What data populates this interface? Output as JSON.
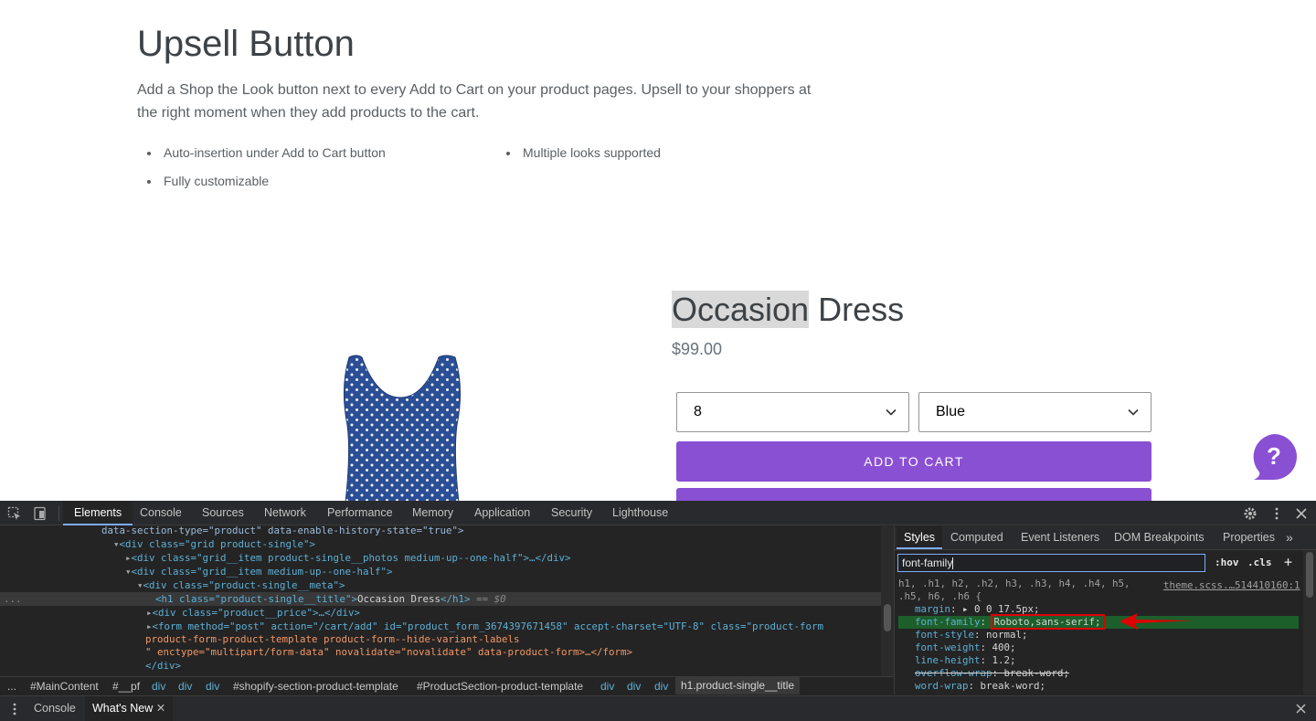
{
  "upsell": {
    "title": "Upsell Button",
    "description": "Add a Shop the Look button next to every Add to Cart on your product pages. Upsell to your shoppers at the right moment when they add products to the cart.",
    "features": [
      "Auto-insertion under Add to Cart button",
      "Multiple looks supported",
      "Fully customizable"
    ]
  },
  "product": {
    "title_highlighted": "Occasion",
    "title_rest": " Dress",
    "price": "$99.00",
    "size_value": "8",
    "color_value": "Blue",
    "add_to_cart_label": "ADD TO CART",
    "button_color": "#8a50d4"
  },
  "help": {
    "icon": "question-mark-icon",
    "glyph": "?"
  },
  "devtools": {
    "tabs": [
      "Elements",
      "Console",
      "Sources",
      "Network",
      "Performance",
      "Memory",
      "Application",
      "Security",
      "Lighthouse"
    ],
    "elements": {
      "l1_attrs": "data-section-type=\"product\" data-enable-history-state=\"true\">",
      "l2": "<div class=\"grid product-single\">",
      "l3": "<div class=\"grid__item product-single__photos medium-up--one-half\">…</div>",
      "l4": "<div class=\"grid__item medium-up--one-half\">",
      "l5": "<div class=\"product-single__meta\">",
      "l6_open": "<h1 class=\"product-single__title\">",
      "l6_text": "Occasion Dress",
      "l6_close": "</h1>",
      "l6_ref": "== $0",
      "l7": "<div class=\"product__price\">…</div>",
      "l8": "<form method=\"post\" action=\"/cart/add\" id=\"product_form_3674397671458\" accept-charset=\"UTF-8\" class=\"product-form",
      "l9": "product-form-product-template product-form--hide-variant-labels",
      "l10": "\" enctype=\"multipart/form-data\" novalidate=\"novalidate\" data-product-form>…</form>",
      "l11": "</div>"
    },
    "breadcrumbs": [
      "...",
      "#MainContent",
      "#__pf",
      "div",
      "div",
      "div",
      "#shopify-section-product-template",
      "#ProductSection-product-template",
      "div",
      "div",
      "div",
      "h1.product-single__title"
    ],
    "styles_tabs": [
      "Styles",
      "Computed",
      "Event Listeners",
      "DOM Breakpoints",
      "Properties"
    ],
    "filter_value": "font-family",
    "hov": ":hov",
    "cls": ".cls",
    "add": "+",
    "selector_line1": "h1, .h1, h2, .h2, h3, .h3, h4, .h4, h5,",
    "selector_line2": ".h5, h6, .h6 {",
    "source": "theme.scss.…514410160:1",
    "rules": [
      {
        "prop": "margin",
        "value": "▸ 0 0 17.5px;",
        "strike": false
      },
      {
        "prop": "font-family",
        "value": "Roboto,sans-serif;",
        "strike": false
      },
      {
        "prop": "font-style",
        "value": "normal;",
        "strike": false
      },
      {
        "prop": "font-weight",
        "value": "400;",
        "strike": false
      },
      {
        "prop": "line-height",
        "value": "1.2;",
        "strike": false
      },
      {
        "prop": "overflow-wrap",
        "value": "break-word;",
        "strike": true
      },
      {
        "prop": "word-wrap",
        "value": "break-word;",
        "strike": false
      }
    ],
    "drawer_tabs": [
      "Console",
      "What's New"
    ],
    "highlight_color": "#e00000",
    "match_color": "#1d5f2b"
  }
}
